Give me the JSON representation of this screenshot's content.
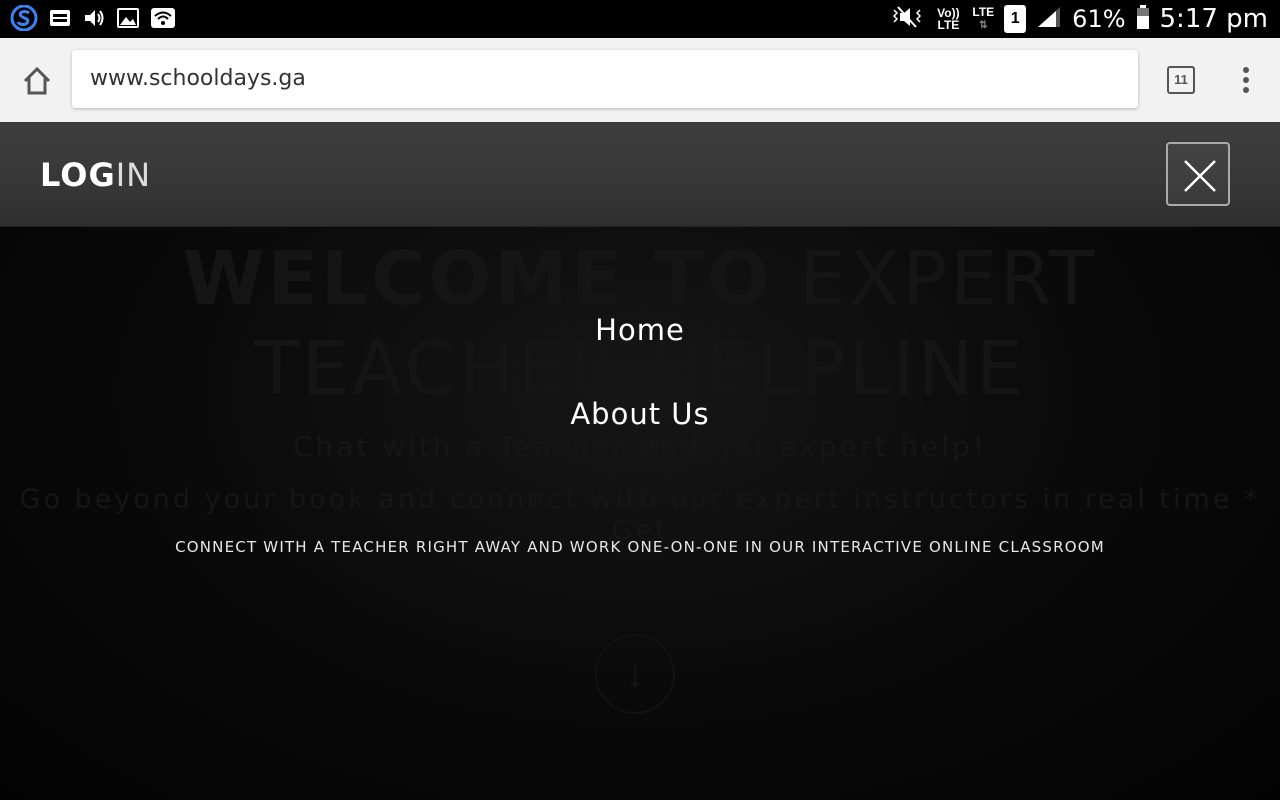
{
  "status_bar": {
    "network_label": "LTE",
    "volte_label": "Vo)) LTE",
    "sim_slot": "1",
    "battery": "61%",
    "time": "5:17 pm",
    "icons": [
      "s-app-icon",
      "notification-tray-icon",
      "volume-icon",
      "image-icon",
      "wifi-icon",
      "vibrate-mute-icon",
      "signal-icon",
      "battery-icon"
    ]
  },
  "browser": {
    "url": "www.schooldays.ga",
    "tab_count": "11"
  },
  "site": {
    "logo_bold": "LOG",
    "logo_light": "IN",
    "hero_title_bold": "WELCOME TO",
    "hero_title_light": "EXPERT TEACHER HELPLINE",
    "hero_subtitle": "Chat with a Teacher and get expert help!",
    "hero_description": "Go beyond your book and connect with our expert instructors in real time * Get",
    "tagline": "CONNECT WITH A TEACHER RIGHT AWAY AND WORK ONE-ON-ONE IN OUR INTERACTIVE ONLINE CLASSROOM"
  },
  "menu": {
    "items": [
      {
        "label": "Home"
      },
      {
        "label": "About Us"
      }
    ]
  },
  "colors": {
    "overlay_header": "#3a3a3a",
    "page_bg": "#080808",
    "browser_bar": "#f2f2f2"
  }
}
